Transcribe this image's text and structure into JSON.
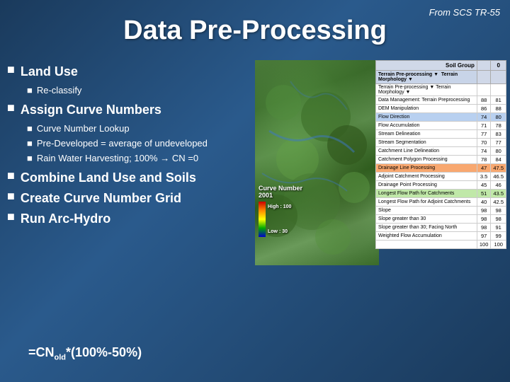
{
  "header": {
    "source": "From SCS TR-55",
    "title": "Data Pre-Processing"
  },
  "bullets": [
    {
      "id": "land-use",
      "text": "Land Use",
      "sub_items": [
        {
          "text": "Re-classify"
        }
      ]
    },
    {
      "id": "assign-curve-numbers",
      "text": "Assign Curve Numbers",
      "sub_items": [
        {
          "text": "Curve Number Lookup"
        },
        {
          "text": "Pre-Developed = average of undeveloped"
        },
        {
          "text": "Rain Water Harvesting; 100% → CN =0"
        }
      ]
    },
    {
      "id": "combine-land-use",
      "text": "Combine Land Use and Soils",
      "sub_items": []
    },
    {
      "id": "create-curve-grid",
      "text": "Create Curve Number Grid",
      "sub_items": []
    },
    {
      "id": "run-arc-hydro",
      "text": "Run Arc-Hydro",
      "sub_items": []
    }
  ],
  "formula": "=CN",
  "formula_sub": "old",
  "formula_rest": "*(100%-50%)",
  "map": {
    "label": "Curve Number\n2001",
    "high": "High : 100",
    "low": "Low : 30"
  },
  "table": {
    "headers": [
      "",
      "Soil Group",
      "",
      ""
    ],
    "col_headers": [
      "",
      "0",
      ""
    ],
    "rows": [
      {
        "label": "Terrain Pre-processing ▼  Terrain Morphology ▼",
        "cols": [
          "",
          ""
        ],
        "highlight": false
      },
      {
        "label": "Data Management: Terrain Preprocessing",
        "cols": [
          "88",
          "81"
        ],
        "highlight": false
      },
      {
        "label": "DEM Manipulation",
        "cols": [
          "86",
          "88"
        ],
        "highlight": false
      },
      {
        "label": "Flow Direction",
        "cols": [
          "74",
          "80"
        ],
        "highlight": true
      },
      {
        "label": "Flow Accumulation",
        "cols": [
          "71",
          "78"
        ],
        "highlight": false
      },
      {
        "label": "Stream Delineation",
        "cols": [
          "77",
          "83"
        ],
        "highlight": false
      },
      {
        "label": "Stream Segmentation",
        "cols": [
          "70",
          "77"
        ],
        "highlight": false
      },
      {
        "label": "Catchment Line Delineation",
        "cols": [
          "74",
          "80"
        ],
        "highlight": false
      },
      {
        "label": "Catchment Polygon Processing",
        "cols": [
          "78",
          "84"
        ],
        "highlight": false
      },
      {
        "label": "Drainage Line Processing",
        "cols": [
          "47",
          "47.5"
        ],
        "highlight": true,
        "orange": true
      },
      {
        "label": "Adjoint Catchment Processing",
        "cols": [
          "3.5",
          "46.5"
        ],
        "highlight": false
      },
      {
        "label": "Drainage Point Processing",
        "cols": [
          "45",
          "46"
        ],
        "highlight": false
      },
      {
        "label": "Longest Flow Path for Catchments",
        "cols": [
          "51",
          "43.5"
        ],
        "highlight": false,
        "green": true
      },
      {
        "label": "Longest Flow Path for Adjoint Catchments",
        "cols": [
          "40",
          "42.5"
        ],
        "highlight": false
      },
      {
        "label": "Slope",
        "cols": [
          "98",
          "98"
        ],
        "highlight": false
      },
      {
        "label": "Slope greater than 30",
        "cols": [
          "98",
          "98"
        ],
        "highlight": false
      },
      {
        "label": "Slope greater than 30; Facing North",
        "cols": [
          "98",
          "91"
        ],
        "highlight": false
      },
      {
        "label": "Weighted Flow Accumulation",
        "cols": [
          "97",
          "99"
        ],
        "highlight": false
      },
      {
        "label": "",
        "cols": [
          "100",
          "100"
        ],
        "highlight": false
      }
    ]
  }
}
